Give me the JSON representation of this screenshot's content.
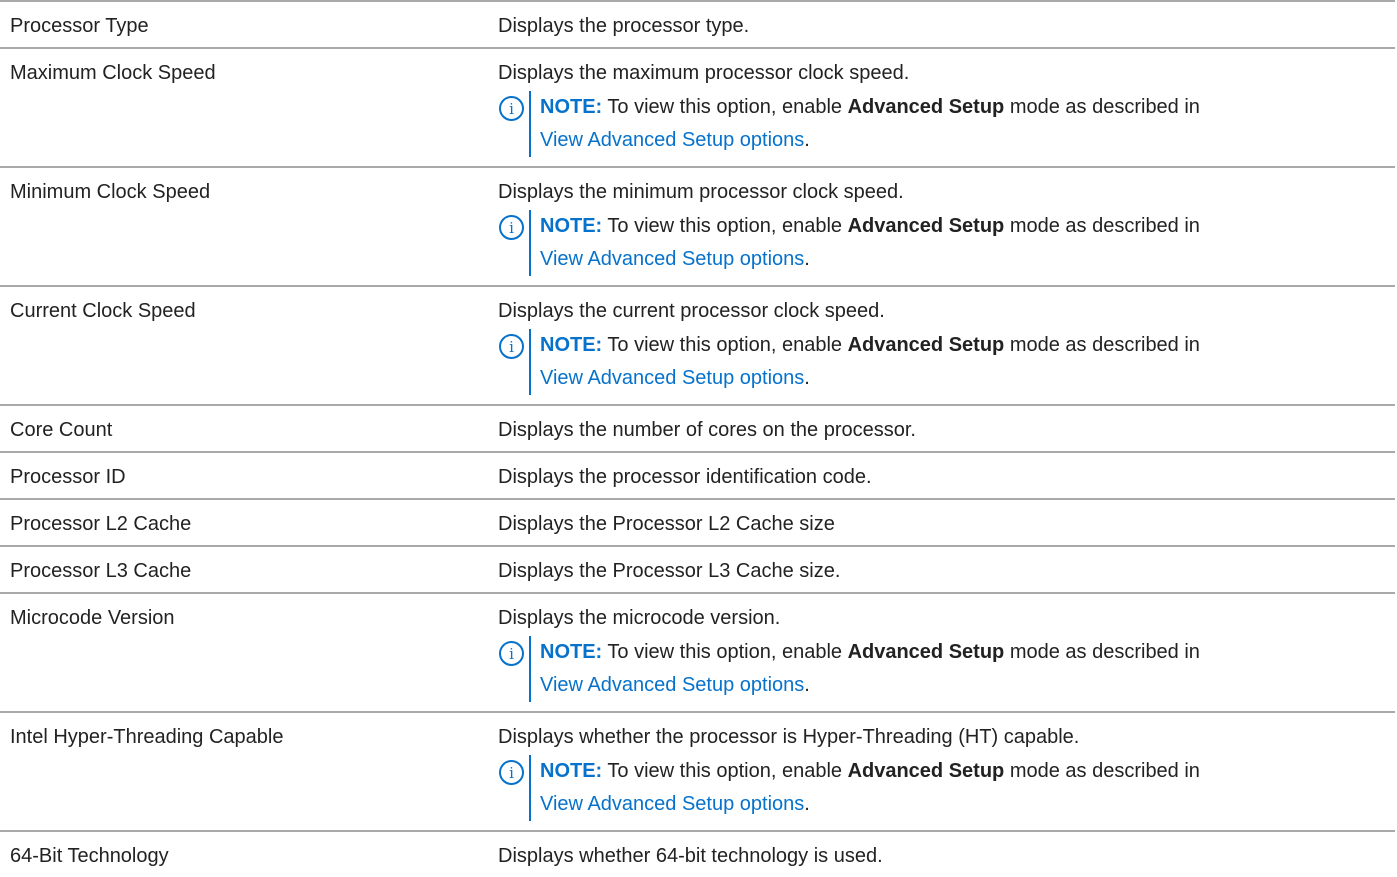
{
  "rows": [
    {
      "name": "Processor Type",
      "desc": "Displays the processor type."
    },
    {
      "name": "Maximum Clock Speed",
      "desc": "Displays the maximum processor clock speed."
    },
    {
      "name": "Minimum Clock Speed",
      "desc": "Displays the minimum processor clock speed."
    },
    {
      "name": "Current Clock Speed",
      "desc": "Displays the current processor clock speed."
    },
    {
      "name": "Core Count",
      "desc": "Displays the number of cores on the processor."
    },
    {
      "name": "Processor ID",
      "desc": "Displays the processor identification code."
    },
    {
      "name": "Processor L2 Cache",
      "desc": "Displays the Processor L2 Cache size"
    },
    {
      "name": "Processor L3 Cache",
      "desc": "Displays the Processor L3 Cache size."
    },
    {
      "name": "Microcode Version",
      "desc": "Displays the microcode version."
    },
    {
      "name": "Intel Hyper-Threading Capable",
      "desc": "Displays whether the processor is Hyper-Threading (HT) capable."
    },
    {
      "name": "64-Bit Technology",
      "desc": "Displays whether 64-bit technology is used."
    }
  ],
  "note": {
    "label": "NOTE:",
    "text_before": " To view this option, enable ",
    "bold": "Advanced Setup",
    "text_after": " mode as described in",
    "link": "View Advanced Setup options",
    "end": "."
  },
  "colors": {
    "accent": "#0672cb",
    "border": "#a9a9a9",
    "text": "#222222"
  },
  "icons": {
    "note": "info-circle-icon"
  }
}
